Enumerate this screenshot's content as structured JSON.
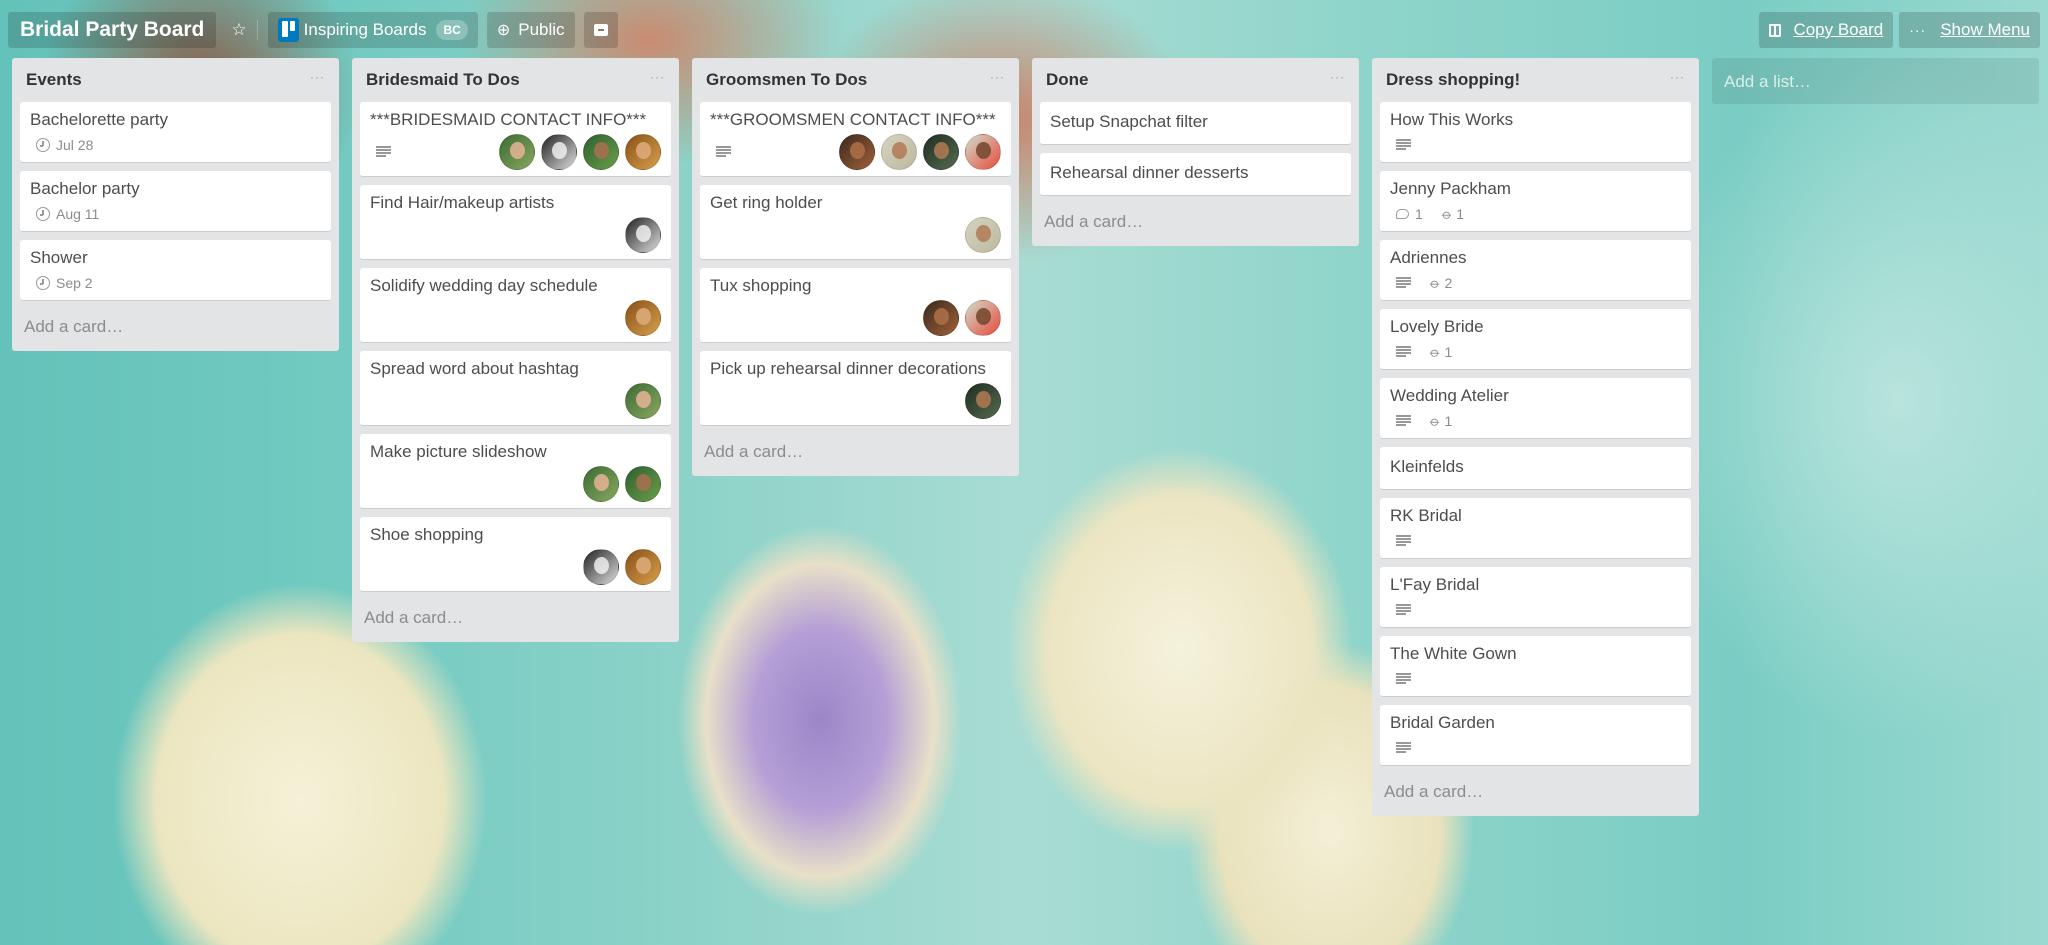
{
  "header": {
    "board_title": "Bridal Party Board",
    "star_icon": "star-icon",
    "team_name": "Inspiring Boards",
    "team_badge": "BC",
    "visibility": "Public",
    "copy_board": "Copy Board",
    "show_menu": "Show Menu",
    "menu_dots": "···"
  },
  "list_menu_dots": "···",
  "add_card": "Add a card…",
  "add_list": "Add a list…",
  "lists": [
    {
      "title": "Events",
      "cards": [
        {
          "title": "Bachelorette party",
          "due": "Jul 28"
        },
        {
          "title": "Bachelor party",
          "due": "Aug 11"
        },
        {
          "title": "Shower",
          "due": "Sep 2"
        }
      ]
    },
    {
      "title": "Bridesmaid To Dos",
      "cards": [
        {
          "title": "***BRIDESMAID CONTACT INFO***",
          "description": true,
          "members": 4
        },
        {
          "title": "Find Hair/makeup artists",
          "members": 1
        },
        {
          "title": "Solidify wedding day schedule",
          "members": 1
        },
        {
          "title": "Spread word about hashtag",
          "members": 1
        },
        {
          "title": "Make picture slideshow",
          "members": 2
        },
        {
          "title": "Shoe shopping",
          "members": 2
        }
      ]
    },
    {
      "title": "Groomsmen To Dos",
      "cards": [
        {
          "title": "***GROOMSMEN CONTACT INFO***",
          "description": true,
          "members": 4
        },
        {
          "title": "Get ring holder",
          "members": 1
        },
        {
          "title": "Tux shopping",
          "members": 2
        },
        {
          "title": "Pick up rehearsal dinner decorations",
          "members": 1
        }
      ]
    },
    {
      "title": "Done",
      "cards": [
        {
          "title": "Setup Snapchat filter"
        },
        {
          "title": "Rehearsal dinner desserts"
        }
      ]
    },
    {
      "title": "Dress shopping!",
      "cards": [
        {
          "title": "How This Works",
          "description": true
        },
        {
          "title": "Jenny Packham",
          "comments": "1",
          "attachments": "1"
        },
        {
          "title": "Adriennes",
          "description": true,
          "attachments": "2"
        },
        {
          "title": "Lovely Bride",
          "description": true,
          "attachments": "1"
        },
        {
          "title": "Wedding Atelier",
          "description": true,
          "attachments": "1"
        },
        {
          "title": "Kleinfelds"
        },
        {
          "title": "RK Bridal",
          "description": true
        },
        {
          "title": "L'Fay Bridal",
          "description": true
        },
        {
          "title": "The White Gown",
          "description": true
        },
        {
          "title": "Bridal Garden",
          "description": true
        }
      ]
    }
  ],
  "colors": {
    "list_bg": "#e2e4e6",
    "trello_blue": "#0079bf"
  }
}
